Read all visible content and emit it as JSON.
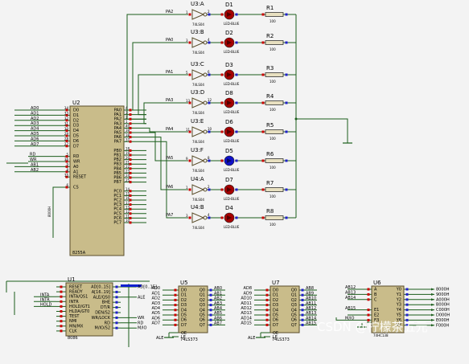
{
  "u2": {
    "ref": "U2",
    "part": "8255A",
    "left_pins": [
      "D0",
      "D1",
      "D2",
      "D3",
      "D4",
      "D5",
      "D6",
      "D7",
      "",
      "RD",
      "WR",
      "A0",
      "A1",
      "RESET",
      "",
      "CS"
    ],
    "left_nums": [
      "34",
      "33",
      "32",
      "31",
      "30",
      "29",
      "28",
      "27",
      "",
      "5",
      "36",
      "9",
      "8",
      "35",
      "",
      "6"
    ],
    "left_nets": [
      "AD0",
      "AD1",
      "AD2",
      "AD3",
      "AD4",
      "AD5",
      "AD6",
      "AD7",
      "",
      "RD",
      "WR",
      "AB1",
      "AB2",
      "",
      "",
      "8000H"
    ],
    "right_pins": [
      "PA0",
      "PA1",
      "PA2",
      "PA3",
      "PA4",
      "PA5",
      "PA6",
      "PA7",
      "",
      "PB0",
      "PB1",
      "PB2",
      "PB3",
      "PB4",
      "PB5",
      "PB6",
      "PB7",
      "",
      "PC0",
      "PC1",
      "PC2",
      "PC3",
      "PC4",
      "PC5",
      "PC6",
      "PC7"
    ],
    "right_nums": [
      "4",
      "3",
      "2",
      "1",
      "40",
      "39",
      "38",
      "37",
      "",
      "18",
      "19",
      "20",
      "21",
      "22",
      "23",
      "24",
      "25",
      "",
      "14",
      "15",
      "16",
      "17",
      "13",
      "12",
      "11",
      "10"
    ]
  },
  "channels": [
    {
      "net": "PA2",
      "gate": "U3:A",
      "pin_in": "1",
      "pin_out": "2",
      "led": "D1",
      "res": "R1",
      "value": "100",
      "type": "74LS04",
      "led_type": "LED-BLUE",
      "lit": false
    },
    {
      "net": "PA0",
      "gate": "U3:B",
      "pin_in": "3",
      "pin_out": "4",
      "led": "D2",
      "res": "R2",
      "value": "100",
      "type": "74LS04",
      "led_type": "LED-BLUE",
      "lit": false
    },
    {
      "net": "PA1",
      "gate": "U3:C",
      "pin_in": "5",
      "pin_out": "6",
      "led": "D3",
      "res": "R3",
      "value": "100",
      "type": "74LS04",
      "led_type": "LED-BLUE",
      "lit": false
    },
    {
      "net": "PA3",
      "gate": "U3:D",
      "pin_in": "13",
      "pin_out": "12",
      "led": "D8",
      "res": "R4",
      "value": "100",
      "type": "74LS04",
      "led_type": "LED-BLUE",
      "lit": false
    },
    {
      "net": "PA4",
      "gate": "U3:E",
      "pin_in": "11",
      "pin_out": "10",
      "led": "D6",
      "res": "R5",
      "value": "100",
      "type": "74LS04",
      "led_type": "LED-BLUE",
      "lit": false
    },
    {
      "net": "PA5",
      "gate": "U3:F",
      "pin_in": "9",
      "pin_out": "8",
      "led": "D5",
      "res": "R6",
      "value": "100",
      "type": "74LS04",
      "led_type": "LED-BLUE",
      "lit": true
    },
    {
      "net": "PA6",
      "gate": "U4:A",
      "pin_in": "1",
      "pin_out": "2",
      "led": "D7",
      "res": "R7",
      "value": "100",
      "type": "74LS04",
      "led_type": "LED-BLUE",
      "lit": false
    },
    {
      "net": "PA7",
      "gate": "U4:B",
      "pin_in": "3",
      "pin_out": "4",
      "led": "D4",
      "res": "R8",
      "value": "100",
      "type": "74LS04",
      "led_type": "LED-BLUE",
      "lit": false
    }
  ],
  "u1": {
    "ref": "U1",
    "part": "8086",
    "left_pins": [
      "RESET",
      "READY",
      "INTA/QS1",
      "INTR",
      "HOLD/GT1",
      "HLDA/GT0",
      "TEST",
      "NMI",
      "MN/MX",
      "CLK"
    ],
    "left_nets": [
      "",
      "",
      "INTA",
      "INTR",
      "HOLD",
      "",
      "",
      "",
      "",
      ""
    ],
    "right_pins": [
      "AD[0..15]",
      "A[16..19]",
      "ALE/QS0",
      "BHE",
      "DT/R",
      "DEN/S2",
      "WR/LOCK",
      "RD",
      "M/IO/S2"
    ],
    "right_nets": [
      "AD[0..15]",
      "",
      "ALE",
      "",
      "",
      "",
      "WR",
      "RD",
      "M/IO"
    ]
  },
  "u5": {
    "ref": "U5",
    "part": "74LS373",
    "in_nets": [
      "AD0",
      "AD1",
      "AD2",
      "AD3",
      "AD4",
      "AD5",
      "AD6",
      "AD7"
    ],
    "out_nets": [
      "AB0",
      "AB1",
      "AB2",
      "AB3",
      "AB4",
      "AB5",
      "AB6",
      "AB7"
    ],
    "d_pins": [
      "D0",
      "D1",
      "D2",
      "D3",
      "D4",
      "D5",
      "D6",
      "D7"
    ],
    "q_pins": [
      "Q0",
      "Q1",
      "Q2",
      "Q3",
      "Q4",
      "Q5",
      "Q6",
      "Q7"
    ],
    "ctrl": [
      "OE",
      "LE"
    ],
    "ctrl_net": "ALE"
  },
  "u7": {
    "ref": "U7",
    "part": "74LS373",
    "in_nets": [
      "AD8",
      "AD9",
      "AD10",
      "AD11",
      "AD12",
      "AD13",
      "AD14",
      "AD15"
    ],
    "out_nets": [
      "AB8",
      "AB9",
      "AB10",
      "AB11",
      "AB12",
      "AB13",
      "AB14",
      "AB15"
    ],
    "d_pins": [
      "D0",
      "D1",
      "D2",
      "D3",
      "D4",
      "D5",
      "D6",
      "D7"
    ],
    "q_pins": [
      "Q0",
      "Q1",
      "Q2",
      "Q3",
      "Q4",
      "Q5",
      "Q6",
      "Q7"
    ],
    "ctrl": [
      "OE",
      "LE"
    ],
    "ctrl_net": "ALE"
  },
  "u6": {
    "ref": "U6",
    "part": "74HC138",
    "in_pins": [
      "A",
      "B",
      "C",
      "",
      "E1",
      "E2",
      "E3"
    ],
    "in_nets": [
      "AB12",
      "AB13",
      "AB14",
      "",
      "AB15",
      "",
      "M/IO"
    ],
    "out_pins": [
      "Y0",
      "Y1",
      "Y2",
      "Y3",
      "Y4",
      "Y5",
      "Y6",
      "Y7"
    ],
    "out_nets": [
      "8000H",
      "9000H",
      "A000H",
      "B000H",
      "C000H",
      "D000H",
      "E000H",
      "F000H"
    ]
  },
  "watermark": "CSDN @柠檬茶五元",
  "colors": {
    "wire": "#1b5e1b",
    "body": "#c9bc8a",
    "led_off": "#a60000",
    "led_on": "#1010c8",
    "pin_red": "#cc0000",
    "pin_blue": "#2020cc"
  }
}
